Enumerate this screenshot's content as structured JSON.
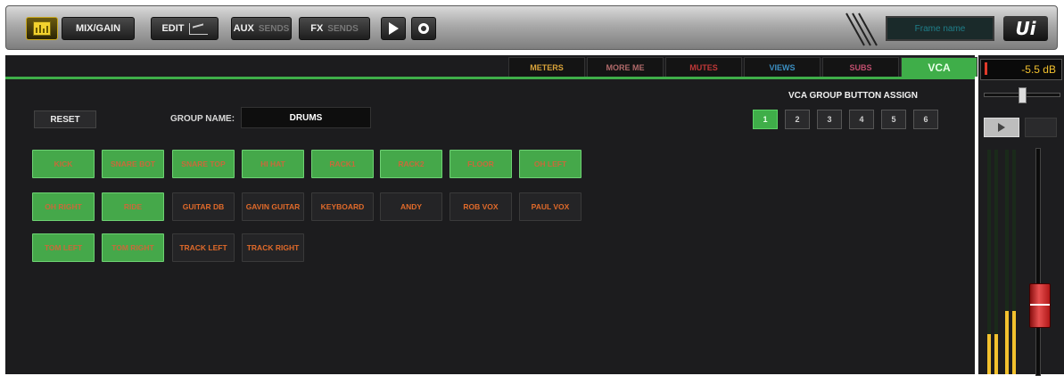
{
  "toolbar": {
    "meters_icon": "meters-icon",
    "mix_gain_label": "MIX/GAIN",
    "edit_label": "EDIT",
    "aux_label": "AUX",
    "aux_sub": "SENDS",
    "fx_label": "FX",
    "fx_sub": "SENDS",
    "play_icon": "play-icon",
    "record_icon": "record-icon",
    "mic_display": "Frame name",
    "logo": "Ui"
  },
  "tabs": [
    {
      "label": "METERS",
      "color": "#d9a33a"
    },
    {
      "label": "MORE ME",
      "color": "#b06a6a"
    },
    {
      "label": "MUTES",
      "color": "#c03838"
    },
    {
      "label": "VIEWS",
      "color": "#3c8fc2"
    },
    {
      "label": "SUBS",
      "color": "#c04e6e"
    },
    {
      "label": "VCA",
      "color": "#e8ffe8",
      "active": true
    }
  ],
  "vca_panel": {
    "reset_label": "RESET",
    "group_name_label": "GROUP NAME:",
    "group_name_value": "DRUMS",
    "assign_title": "VCA GROUP BUTTON ASSIGN",
    "buttons": [
      {
        "label": "1",
        "on": true
      },
      {
        "label": "2",
        "on": false
      },
      {
        "label": "3",
        "on": false
      },
      {
        "label": "4",
        "on": false
      },
      {
        "label": "5",
        "on": false
      },
      {
        "label": "6",
        "on": false
      }
    ]
  },
  "channels": [
    {
      "label": "KICK",
      "on": true
    },
    {
      "label": "SNARE BOT",
      "on": true
    },
    {
      "label": "SNARE TOP",
      "on": true
    },
    {
      "label": "HI HAT",
      "on": true
    },
    {
      "label": "RACK1",
      "on": true
    },
    {
      "label": "RACK2",
      "on": true
    },
    {
      "label": "FLOOR",
      "on": true
    },
    {
      "label": "OH LEFT",
      "on": true
    },
    {
      "label": "OH RIGHT",
      "on": true
    },
    {
      "label": "RIDE",
      "on": true
    },
    {
      "label": "GUITAR DB",
      "on": false
    },
    {
      "label": "GAVIN GUITAR",
      "on": false
    },
    {
      "label": "KEYBOARD",
      "on": false
    },
    {
      "label": "ANDY",
      "on": false
    },
    {
      "label": "ROB VOX",
      "on": false
    },
    {
      "label": "PAUL VOX",
      "on": false
    },
    {
      "label": "TOM LEFT",
      "on": true
    },
    {
      "label": "TOM RIGHT",
      "on": true
    },
    {
      "label": "TRACK LEFT",
      "on": false
    },
    {
      "label": "TRACK RIGHT",
      "on": false
    }
  ],
  "strip": {
    "level_db": "-5.5 dB",
    "pan_position": 0.5,
    "fader_level": 0.22,
    "meter_levels": [
      0.18,
      0.18,
      0.28,
      0.28
    ],
    "meter_color": "#f2c12e"
  },
  "colors": {
    "accent": "#3fae49",
    "channel_on": "#45a84a",
    "channel_off": "#242426",
    "label_orange": "#e06a2a"
  }
}
